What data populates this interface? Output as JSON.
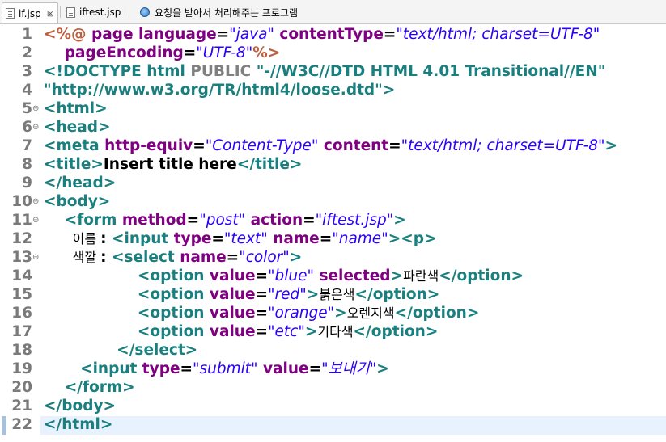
{
  "tabs": [
    {
      "label": "if.jsp",
      "active": true,
      "icon": "file-icon"
    },
    {
      "label": "iftest.jsp",
      "active": false,
      "icon": "file-icon"
    },
    {
      "label": "요청을 받아서 처리해주는 프로그램",
      "active": false,
      "icon": "globe-icon"
    }
  ],
  "close_symbol": "⊠",
  "fold_marker": "⊖",
  "lines": [
    {
      "n": "1",
      "fold": false,
      "tokens": [
        {
          "t": "<%@ ",
          "c": "dr"
        },
        {
          "t": "page ",
          "c": "at"
        },
        {
          "t": "language",
          "c": "at"
        },
        {
          "t": "=",
          "c": "tx"
        },
        {
          "t": "\"java\"",
          "c": "vl"
        },
        {
          "t": " contentType",
          "c": "at"
        },
        {
          "t": "=",
          "c": "tx"
        },
        {
          "t": "\"text/html; charset=UTF-8\"",
          "c": "vl"
        }
      ]
    },
    {
      "n": "2",
      "fold": false,
      "tokens": [
        {
          "t": "    pageEncoding",
          "c": "at"
        },
        {
          "t": "=",
          "c": "tx"
        },
        {
          "t": "\"UTF-8\"",
          "c": "vl"
        },
        {
          "t": "%>",
          "c": "dr"
        }
      ]
    },
    {
      "n": "3",
      "fold": false,
      "tokens": [
        {
          "t": "<!DOCTYPE html ",
          "c": "tg"
        },
        {
          "t": "PUBLIC ",
          "c": "gr"
        },
        {
          "t": "\"-//W3C//DTD HTML 4.01 Transitional//EN\"",
          "c": "tg"
        }
      ]
    },
    {
      "n": "4",
      "fold": false,
      "tokens": [
        {
          "t": "\"http://www.w3.org/TR/html4/loose.dtd\">",
          "c": "tg"
        }
      ]
    },
    {
      "n": "5",
      "fold": true,
      "tokens": [
        {
          "t": "<html>",
          "c": "tg"
        }
      ]
    },
    {
      "n": "6",
      "fold": true,
      "tokens": [
        {
          "t": "<head>",
          "c": "tg"
        }
      ]
    },
    {
      "n": "7",
      "fold": false,
      "tokens": [
        {
          "t": "<meta ",
          "c": "tg"
        },
        {
          "t": "http-equiv",
          "c": "at"
        },
        {
          "t": "=",
          "c": "tx"
        },
        {
          "t": "\"Content-Type\"",
          "c": "vl"
        },
        {
          "t": " content",
          "c": "at"
        },
        {
          "t": "=",
          "c": "tx"
        },
        {
          "t": "\"text/html; charset=UTF-8\"",
          "c": "vl"
        },
        {
          "t": ">",
          "c": "tg"
        }
      ]
    },
    {
      "n": "8",
      "fold": false,
      "tokens": [
        {
          "t": "<title>",
          "c": "tg"
        },
        {
          "t": "Insert title here",
          "c": "tx"
        },
        {
          "t": "</title>",
          "c": "tg"
        }
      ]
    },
    {
      "n": "9",
      "fold": false,
      "tokens": [
        {
          "t": "</head>",
          "c": "tg"
        }
      ]
    },
    {
      "n": "10",
      "fold": true,
      "tokens": [
        {
          "t": "<body>",
          "c": "tg"
        }
      ]
    },
    {
      "n": "11",
      "fold": true,
      "tokens": [
        {
          "t": "    <form ",
          "c": "tg"
        },
        {
          "t": "method",
          "c": "at"
        },
        {
          "t": "=",
          "c": "tx"
        },
        {
          "t": "\"post\"",
          "c": "vl"
        },
        {
          "t": " action",
          "c": "at"
        },
        {
          "t": "=",
          "c": "tx"
        },
        {
          "t": "\"iftest.jsp\"",
          "c": "vl"
        },
        {
          "t": ">",
          "c": "tg"
        }
      ]
    },
    {
      "n": "12",
      "fold": false,
      "tokens": [
        {
          "t": "       이름 ",
          "c": "ko"
        },
        {
          "t": ": ",
          "c": "tx"
        },
        {
          "t": "<input ",
          "c": "tg"
        },
        {
          "t": "type",
          "c": "at"
        },
        {
          "t": "=",
          "c": "tx"
        },
        {
          "t": "\"text\"",
          "c": "vl"
        },
        {
          "t": " name",
          "c": "at"
        },
        {
          "t": "=",
          "c": "tx"
        },
        {
          "t": "\"name\"",
          "c": "vl"
        },
        {
          "t": "><p>",
          "c": "tg"
        }
      ]
    },
    {
      "n": "13",
      "fold": true,
      "tokens": [
        {
          "t": "       색깔 ",
          "c": "ko"
        },
        {
          "t": ": ",
          "c": "tx"
        },
        {
          "t": "<select ",
          "c": "tg"
        },
        {
          "t": "name",
          "c": "at"
        },
        {
          "t": "=",
          "c": "tx"
        },
        {
          "t": "\"color\"",
          "c": "vl"
        },
        {
          "t": ">",
          "c": "tg"
        }
      ]
    },
    {
      "n": "14",
      "fold": false,
      "tokens": [
        {
          "t": "                  <option ",
          "c": "tg"
        },
        {
          "t": "value",
          "c": "at"
        },
        {
          "t": "=",
          "c": "tx"
        },
        {
          "t": "\"blue\"",
          "c": "vl"
        },
        {
          "t": " selected",
          "c": "at"
        },
        {
          "t": ">",
          "c": "tg"
        },
        {
          "t": "파란색",
          "c": "ko"
        },
        {
          "t": "</option>",
          "c": "tg"
        }
      ]
    },
    {
      "n": "15",
      "fold": false,
      "tokens": [
        {
          "t": "                  <option ",
          "c": "tg"
        },
        {
          "t": "value",
          "c": "at"
        },
        {
          "t": "=",
          "c": "tx"
        },
        {
          "t": "\"red\"",
          "c": "vl"
        },
        {
          "t": ">",
          "c": "tg"
        },
        {
          "t": "붉은색",
          "c": "ko"
        },
        {
          "t": "</option>",
          "c": "tg"
        }
      ]
    },
    {
      "n": "16",
      "fold": false,
      "tokens": [
        {
          "t": "                  <option ",
          "c": "tg"
        },
        {
          "t": "value",
          "c": "at"
        },
        {
          "t": "=",
          "c": "tx"
        },
        {
          "t": "\"orange\"",
          "c": "vl"
        },
        {
          "t": ">",
          "c": "tg"
        },
        {
          "t": "오렌지색",
          "c": "ko"
        },
        {
          "t": "</option>",
          "c": "tg"
        }
      ]
    },
    {
      "n": "17",
      "fold": false,
      "tokens": [
        {
          "t": "                  <option ",
          "c": "tg"
        },
        {
          "t": "value",
          "c": "at"
        },
        {
          "t": "=",
          "c": "tx"
        },
        {
          "t": "\"etc\"",
          "c": "vl"
        },
        {
          "t": ">",
          "c": "tg"
        },
        {
          "t": "기타색",
          "c": "ko"
        },
        {
          "t": "</option>",
          "c": "tg"
        }
      ]
    },
    {
      "n": "18",
      "fold": false,
      "tokens": [
        {
          "t": "              </select>",
          "c": "tg"
        }
      ]
    },
    {
      "n": "19",
      "fold": false,
      "tokens": [
        {
          "t": "       <input ",
          "c": "tg"
        },
        {
          "t": "type",
          "c": "at"
        },
        {
          "t": "=",
          "c": "tx"
        },
        {
          "t": "\"submit\"",
          "c": "vl"
        },
        {
          "t": " value",
          "c": "at"
        },
        {
          "t": "=",
          "c": "tx"
        },
        {
          "t": "\"보내기\"",
          "c": "vl"
        },
        {
          "t": ">",
          "c": "tg"
        }
      ]
    },
    {
      "n": "20",
      "fold": false,
      "tokens": [
        {
          "t": "    </form>",
          "c": "tg"
        }
      ]
    },
    {
      "n": "21",
      "fold": false,
      "tokens": [
        {
          "t": "</body>",
          "c": "tg"
        }
      ]
    },
    {
      "n": "22",
      "fold": false,
      "tokens": [
        {
          "t": "</html>",
          "c": "tg"
        }
      ]
    }
  ],
  "colors": {
    "tag": "#1a7f7f",
    "attribute": "#7f0080",
    "value": "#2a00ff",
    "directive": "#bf5f3f",
    "text": "#000000",
    "line_number": "#7a7a7a",
    "current_line": "#e8f2fe"
  }
}
